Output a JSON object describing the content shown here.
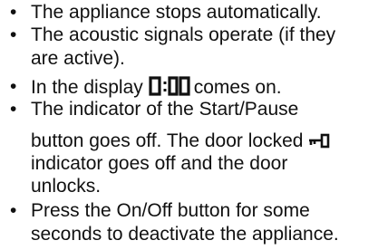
{
  "items": [
    {
      "lines": [
        "The appliance stops automatically."
      ]
    },
    {
      "lines": [
        "The acoustic signals operate (if they",
        "are active)."
      ]
    },
    {
      "line_before": "In the display",
      "display_icon": "seven-segment-0:00-display-icon",
      "line_after": "comes on."
    },
    {
      "lines": [
        "The indicator of the Start/Pause"
      ]
    },
    {
      "line_a": "button goes off. The door locked",
      "key_icon": "door-locked-key-icon",
      "lines_rest": [
        "indicator goes off and the door",
        "unlocks."
      ]
    },
    {
      "lines": [
        "Press the On/Off button for some",
        "seconds to deactivate the appliance."
      ]
    }
  ],
  "bullet_char": "•"
}
